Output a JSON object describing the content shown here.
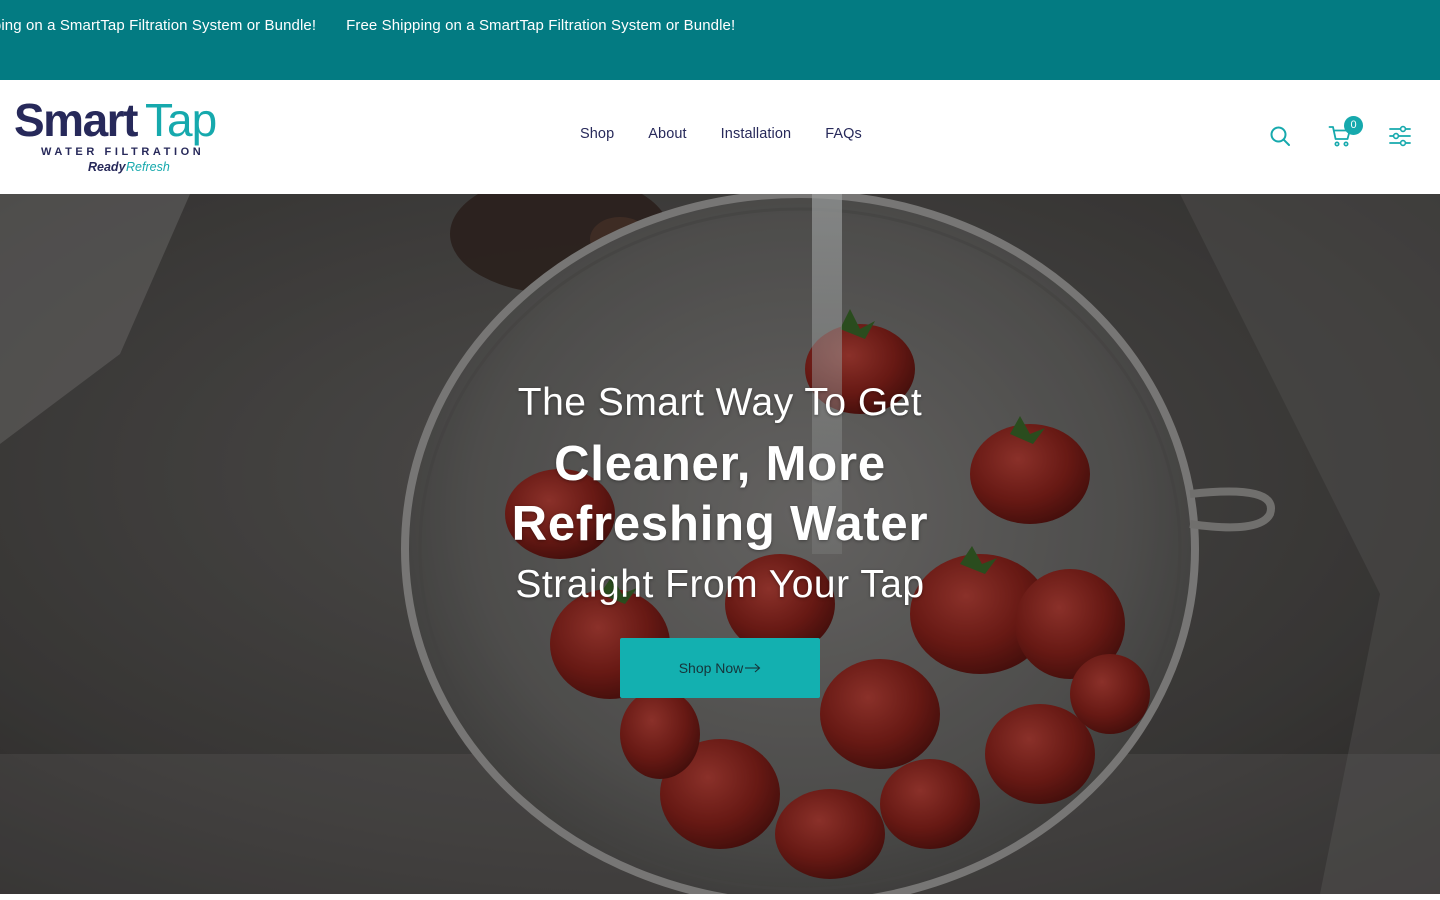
{
  "announcement": {
    "items": [
      "Free Shipping on a SmartTap Filtration System or Bundle!",
      "Free Shipping on a SmartTap Filtration System or Bundle!"
    ],
    "background": "#037b82"
  },
  "logo": {
    "brand_dark": "Smart",
    "brand_light": "Tap",
    "tagline": "WATER FILTRATION",
    "sub_dark": "Ready",
    "sub_light": "Refresh",
    "color_dark": "#27295a",
    "color_accent": "#16a9ad"
  },
  "nav": {
    "items": [
      "Shop",
      "About",
      "Installation",
      "FAQs"
    ]
  },
  "header_icons": {
    "search": "search-icon",
    "cart": "cart-icon",
    "filter": "sliders-icon",
    "cart_count": "0"
  },
  "hero": {
    "line1": "The Smart Way To Get",
    "line2a": "Cleaner, More",
    "line2b": "Refreshing Water",
    "line3": "Straight From Your Tap",
    "cta_label": "Shop Now",
    "cta_icon": "arrow-right-icon",
    "cta_color": "#13b0b0"
  }
}
